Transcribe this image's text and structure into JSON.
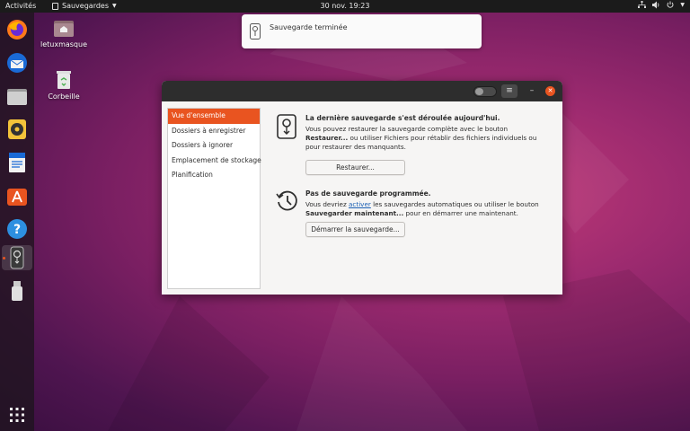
{
  "topbar": {
    "activities": "Activités",
    "app_name": "Sauvegardes",
    "clock": "30 nov.  19:23"
  },
  "desktop": {
    "icons": [
      {
        "label": "letuxmasque"
      },
      {
        "label": "Corbeille"
      }
    ]
  },
  "notification": {
    "text": "Sauvegarde terminée"
  },
  "window": {
    "sidebar": {
      "items": [
        {
          "label": "Vue d'ensemble"
        },
        {
          "label": "Dossiers à enregistrer"
        },
        {
          "label": "Dossiers à ignorer"
        },
        {
          "label": "Emplacement de stockage"
        },
        {
          "label": "Planification"
        }
      ]
    },
    "restore": {
      "title": "La dernière sauvegarde s'est déroulée aujourd'hui.",
      "body_1": "Vous pouvez restaurer la sauvegarde complète avec le bouton",
      "body_bold": "Restaurer...",
      "body_2": " ou utiliser Fichiers pour rétablir des fichiers individuels ou pour restaurer des manquants.",
      "button": "Restaurer..."
    },
    "schedule": {
      "title": "Pas de sauvegarde programmée.",
      "body_1": "Vous devriez ",
      "body_link": "activer",
      "body_2": " les sauvegardes automatiques ou utiliser le bouton ",
      "body_bold": "Sauvegarder maintenant...",
      "body_3": " pour en démarrer une maintenant.",
      "button": "Démarrer la sauvegarde..."
    }
  },
  "colors": {
    "accent": "#e95420",
    "topbar": "#1b1b1b",
    "headerbar": "#2d2d2d"
  }
}
